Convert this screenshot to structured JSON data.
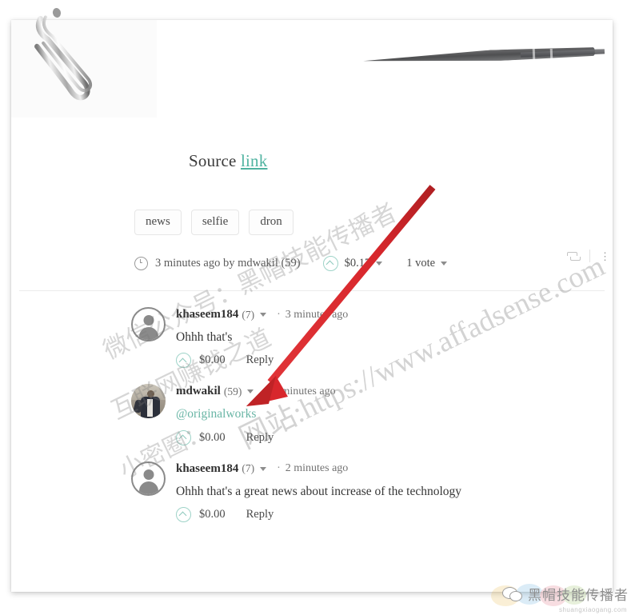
{
  "post": {
    "source_label": "Source",
    "source_link_text": "link",
    "tags": [
      "news",
      "selfie",
      "dron"
    ],
    "meta": {
      "clock_icon": "clock-icon",
      "time_and_author": "3 minutes ago by mdwakil (59)",
      "payout": "$0.17",
      "votes": "1 vote",
      "resteem_icon": "resteem-icon",
      "more_icon": "⋮"
    }
  },
  "comments": [
    {
      "author": "khaseem184",
      "reputation": "(7)",
      "separator": "·",
      "time": "3 minutes ago",
      "body": "Ohhh that's",
      "payout": "$0.00",
      "reply_label": "Reply",
      "avatar_type": "default",
      "is_mention": false
    },
    {
      "author": "mdwakil",
      "reputation": "(59)",
      "separator": "·",
      "time": "3 minutes ago",
      "body": "@originalworks",
      "payout": "$0.00",
      "reply_label": "Reply",
      "avatar_type": "photo",
      "is_mention": true
    },
    {
      "author": "khaseem184",
      "reputation": "(7)",
      "separator": "·",
      "time": "2 minutes ago",
      "body": "Ohhh that's a great news about increase of the technology",
      "payout": "$0.00",
      "reply_label": "Reply",
      "avatar_type": "default",
      "is_mention": false
    }
  ],
  "watermark": {
    "line1": "微信公众号：黑帽技能传播者",
    "line2": "互联网赚钱之道",
    "line3": "小密圈：",
    "line4": "网站:https://www.affadsense.com"
  },
  "brand": {
    "icon": "wechat-icon",
    "text": "黑帽技能传播者",
    "sub": "shuangxiaogang.com"
  },
  "colors": {
    "link_teal": "#4fb3a0",
    "mention_teal": "#6ab6a6",
    "arrow_red": "#d8272c",
    "text_dark": "#303030",
    "text_muted": "#737373"
  }
}
